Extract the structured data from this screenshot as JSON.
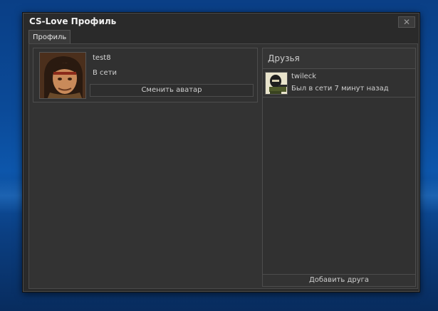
{
  "window": {
    "title": "CS-Love Профиль",
    "close_label": "✕"
  },
  "tabs": [
    {
      "label": "Профиль",
      "active": true
    }
  ],
  "profile": {
    "username": "test8",
    "status": "В сети",
    "change_avatar_label": "Сменить аватар"
  },
  "friends": {
    "title": "Друзья",
    "items": [
      {
        "name": "twileck",
        "status": "Был в сети 7 минут назад"
      }
    ],
    "add_friend_label": "Добавить друга"
  },
  "colors": {
    "window_bg": "#2a2a2a",
    "panel_bg": "#333333",
    "border": "#4d4d4d",
    "text": "#d0d0d0",
    "desktop_blue": "#0b4a98"
  }
}
